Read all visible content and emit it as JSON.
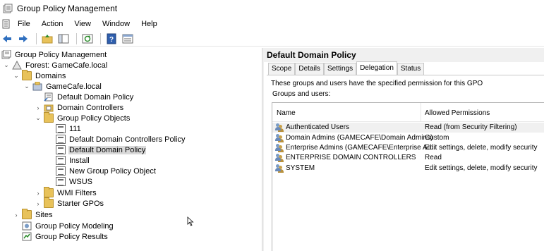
{
  "window": {
    "title": "Group Policy Management"
  },
  "menu": [
    "File",
    "Action",
    "View",
    "Window",
    "Help"
  ],
  "toolbar": {
    "buttons": [
      "back-arrow-icon",
      "forward-arrow-icon",
      "up-folder-icon",
      "show-hide-tree-icon",
      "refresh-icon",
      "help-icon",
      "properties-icon"
    ]
  },
  "tree": {
    "root": "Group Policy Management",
    "forest": "Forest: GameCafe.local",
    "domains": "Domains",
    "domain": "GameCafe.local",
    "default_domain_policy_link": "Default Domain Policy",
    "domain_controllers": "Domain Controllers",
    "gpo_container": "Group Policy Objects",
    "gpos": [
      "111",
      "Default Domain Controllers Policy",
      "Default Domain Policy",
      "Install",
      "New Group Policy Object",
      "WSUS"
    ],
    "wmi_filters": "WMI Filters",
    "starter_gpos": "Starter GPOs",
    "sites": "Sites",
    "modeling": "Group Policy Modeling",
    "results": "Group Policy Results"
  },
  "details": {
    "title": "Default Domain Policy",
    "tabs": [
      "Scope",
      "Details",
      "Settings",
      "Delegation",
      "Status"
    ],
    "active_tab": "Delegation",
    "description": "These groups and users have the specified permission for this GPO",
    "groups_label": "Groups and users:",
    "columns": [
      "Name",
      "Allowed Permissions"
    ],
    "rows": [
      {
        "name": "Authenticated Users",
        "permission": "Read (from Security Filtering)"
      },
      {
        "name": "Domain Admins (GAMECAFE\\Domain Admins)",
        "permission": "Custom"
      },
      {
        "name": "Enterprise Admins (GAMECAFE\\Enterprise Ad...",
        "permission": "Edit settings, delete, modify security"
      },
      {
        "name": "ENTERPRISE DOMAIN CONTROLLERS",
        "permission": "Read"
      },
      {
        "name": "SYSTEM",
        "permission": "Edit settings, delete, modify security"
      }
    ]
  },
  "colors": {
    "folder": "#e8c25a",
    "selection": "#d9d9d9",
    "header_bg": "#f0f0f0",
    "accent_blue": "#2f6fbf"
  }
}
